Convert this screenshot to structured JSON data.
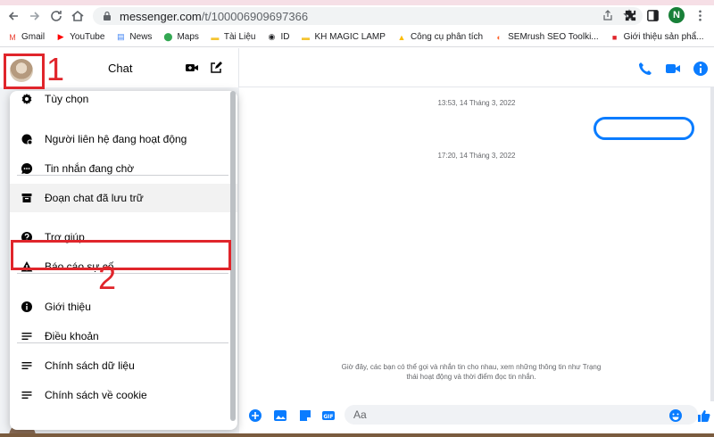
{
  "browser": {
    "url_host": "messenger.com",
    "url_path": "/t/100006909697366",
    "profile_initial": "N"
  },
  "bookmarks": [
    {
      "label": "Gmail",
      "icon": "gmail-icon",
      "color": "#ea4335"
    },
    {
      "label": "YouTube",
      "icon": "youtube-icon",
      "color": "#ff0000"
    },
    {
      "label": "News",
      "icon": "news-icon",
      "color": "#4285f4"
    },
    {
      "label": "Maps",
      "icon": "maps-icon",
      "color": "#34a853"
    },
    {
      "label": "Tài Liệu",
      "icon": "folder-icon",
      "color": "#f4c430"
    },
    {
      "label": "ID",
      "icon": "globe-icon",
      "color": "#202124"
    },
    {
      "label": "KH MAGIC LAMP",
      "icon": "folder-icon",
      "color": "#f4c430"
    },
    {
      "label": "Công cụ phân tích",
      "icon": "analytics-icon",
      "color": "#fbbc04"
    },
    {
      "label": "SEMrush SEO Toolki...",
      "icon": "semrush-icon",
      "color": "#ff642d"
    },
    {
      "label": "Giới thiệu sản phẩ...",
      "icon": "bookmark-red-icon",
      "color": "#e0252b"
    }
  ],
  "left_header": {
    "title": "Chat"
  },
  "annotations": {
    "step1": "1",
    "step2": "2",
    "color": "#e0252b"
  },
  "menu": {
    "items": [
      {
        "label": "Tùy chọn",
        "icon": "gear-icon"
      },
      {
        "label": "Người liên hệ đang hoạt động",
        "icon": "active-contacts-icon"
      },
      {
        "label": "Tin nhắn đang chờ",
        "icon": "message-pending-icon"
      },
      {
        "label": "Đoạn chat đã lưu trữ",
        "icon": "archive-icon"
      },
      {
        "label": "Trợ giúp",
        "icon": "help-icon"
      },
      {
        "label": "Báo cáo sự cố",
        "icon": "warning-icon"
      },
      {
        "label": "Giới thiệu",
        "icon": "info-icon"
      },
      {
        "label": "Điều khoản",
        "icon": "lines-icon"
      },
      {
        "label": "Chính sách dữ liệu",
        "icon": "lines-icon"
      },
      {
        "label": "Chính sách về cookie",
        "icon": "lines-icon"
      }
    ]
  },
  "conversation": {
    "timestamps": [
      "13:53, 14 Tháng 3, 2022",
      "17:20, 14 Tháng 3, 2022"
    ],
    "info_line1": "Giờ đây, các bạn có thể gọi và nhắn tin cho nhau, xem những thông tin như Trạng",
    "info_line2": "thái hoạt động và thời điểm đọc tin nhắn.",
    "input_placeholder": "Aa"
  },
  "colors": {
    "messenger_blue": "#0a7cff",
    "menu_bg": "#ffffff",
    "pane_bg": "#f0f2f5"
  }
}
